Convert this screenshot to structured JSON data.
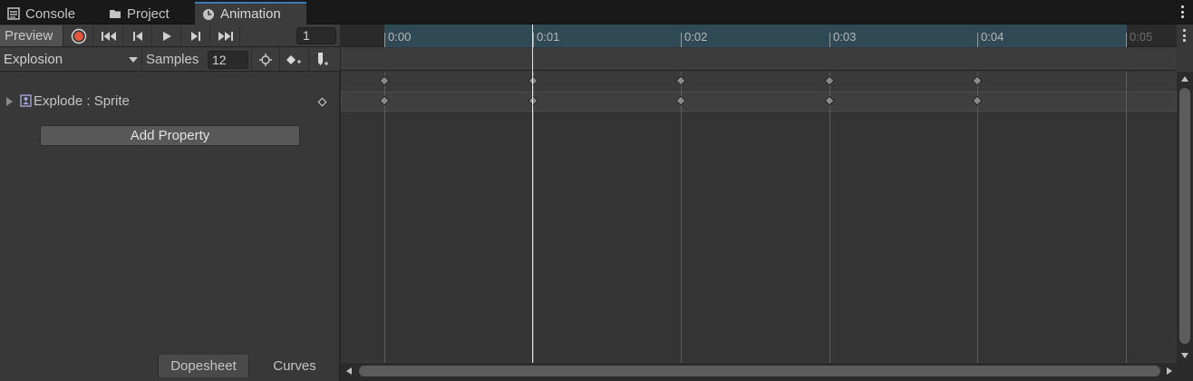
{
  "tabs": [
    {
      "label": "Console",
      "icon": "console-icon",
      "active": false
    },
    {
      "label": "Project",
      "icon": "folder-icon",
      "active": false
    },
    {
      "label": "Animation",
      "icon": "clock-icon",
      "active": true
    }
  ],
  "toolbar": {
    "preview_label": "Preview",
    "record_icon": "record-icon",
    "frame_value": "1",
    "record_color": "#e2583e"
  },
  "clip": {
    "selected": "Explosion",
    "samples_label": "Samples",
    "samples_value": "12"
  },
  "properties": [
    {
      "label": "Explode : Sprite",
      "icon": "sprite-renderer-icon"
    }
  ],
  "add_property_label": "Add Property",
  "bottom_tabs": [
    {
      "label": "Dopesheet",
      "active": true
    },
    {
      "label": "Curves",
      "active": false
    }
  ],
  "timeline": {
    "ticks": [
      "0:00",
      "0:01",
      "0:02",
      "0:03",
      "0:04",
      "0:05"
    ],
    "keyframe_seconds": [
      0,
      1,
      2,
      3,
      4
    ],
    "current_frame": 1,
    "range_color": "#2f4a55"
  }
}
